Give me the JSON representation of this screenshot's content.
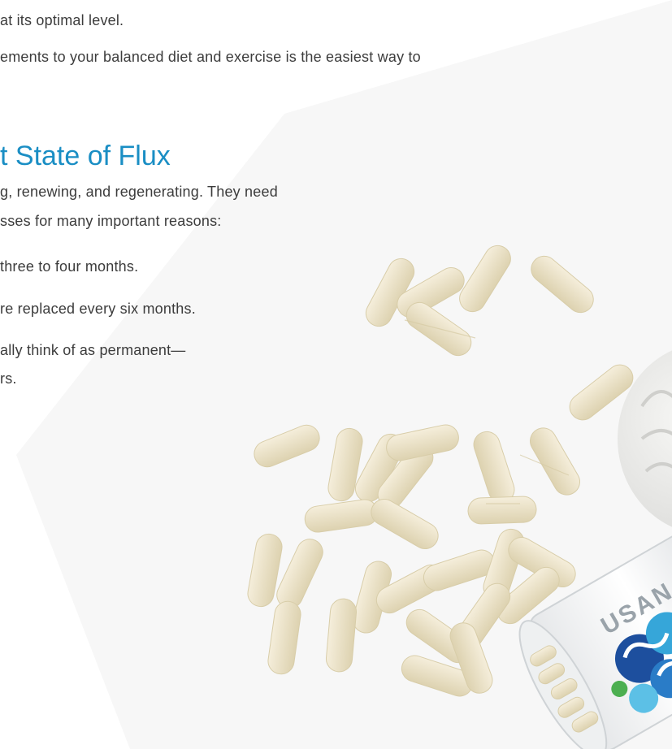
{
  "text": {
    "line1": "at its optimal level.",
    "line2": "ements to your balanced diet and exercise is the easiest way to",
    "heading": "t State of Flux",
    "para_line1": "g, renewing, and regenerating. They need",
    "para_line2": "sses for many important reasons:",
    "bullet1": "three to four months.",
    "bullet2": "re replaced every six months.",
    "bullet3_line1": "ally think of as permanent—",
    "bullet3_line2": "rs."
  },
  "bottle": {
    "label_text": "USAN"
  },
  "colors": {
    "heading": "#1a8ec4",
    "body_text": "#3c3c3c",
    "tablet": "#ece3c6",
    "background_panel": "#f7f7f7"
  }
}
